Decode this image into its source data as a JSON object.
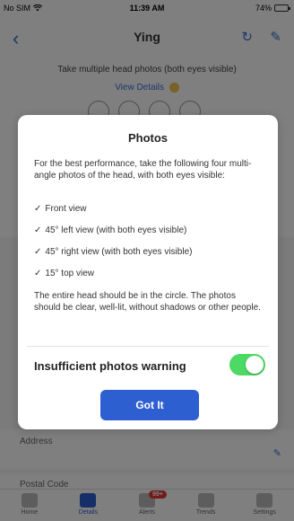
{
  "status_bar": {
    "carrier": "No SIM",
    "time": "11:39 AM",
    "battery_percent": "74%",
    "battery_level": 0.74
  },
  "nav": {
    "title": "Ying",
    "back_icon": "chevron-left-icon",
    "refresh_icon": "refresh-icon",
    "edit_icon": "pencil-icon",
    "accent_color": "#3a6fd8"
  },
  "background": {
    "instruction": "Take multiple head photos (both eyes visible)",
    "view_details": "View Details",
    "fields": [
      {
        "label": "Address"
      },
      {
        "label": "Postal Code"
      }
    ]
  },
  "modal": {
    "title": "Photos",
    "intro": "For the best performance, take the following four multi-angle photos of the head, with both eyes visible:",
    "views": [
      {
        "check": "✓",
        "text": "Front view"
      },
      {
        "check": "✓",
        "text": "45° left view (with both eyes visible)"
      },
      {
        "check": "✓",
        "text": "45° right view (with both eyes visible)"
      },
      {
        "check": "✓",
        "text": "15° top view"
      }
    ],
    "note": "The entire head should be in the circle. The photos should be clear, well-lit, without shadows or other people.",
    "warning_label": "Insufficient photos warning",
    "warning_enabled": true,
    "toggle_color": "#4cd964",
    "button_label": "Got It",
    "button_color": "#2e5fd0"
  },
  "tab_bar": {
    "tabs": [
      {
        "label": "Home",
        "active": false
      },
      {
        "label": "Details",
        "active": true
      },
      {
        "label": "Alerts",
        "active": false,
        "badge": "99+"
      },
      {
        "label": "Trends",
        "active": false
      },
      {
        "label": "Settings",
        "active": false
      }
    ]
  }
}
